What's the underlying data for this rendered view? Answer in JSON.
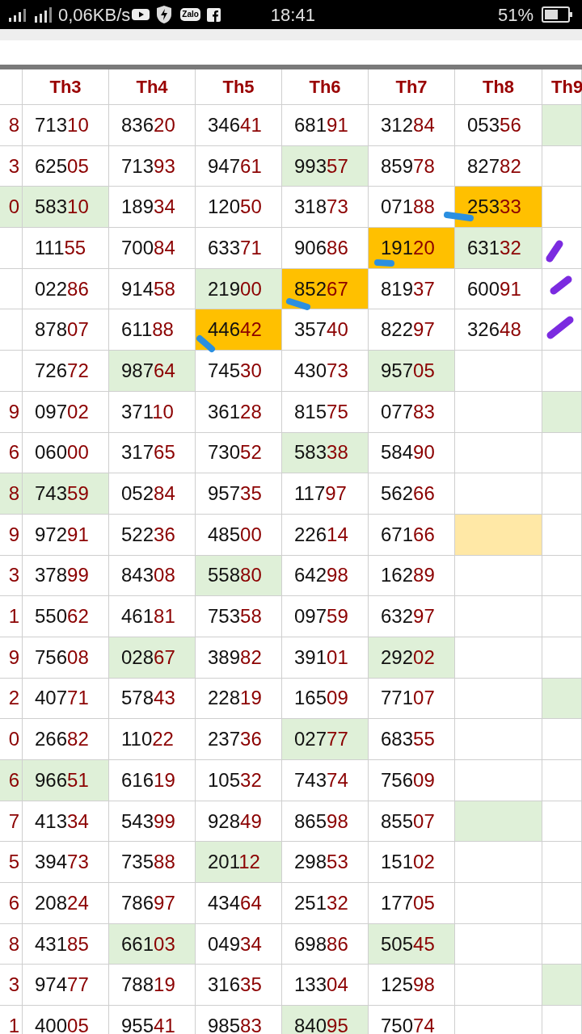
{
  "status_bar": {
    "speed": "0,06KB/s",
    "zalo": "Zalo",
    "time": "18:41",
    "battery": "51%"
  },
  "table": {
    "columns": [
      "",
      "Th3",
      "Th4",
      "Th5",
      "Th6",
      "Th7",
      "Th8",
      "Th9"
    ],
    "rows": [
      {
        "cells": [
          {
            "text": "8"
          },
          {
            "text": "71310"
          },
          {
            "text": "83620"
          },
          {
            "text": "34641"
          },
          {
            "text": "68191"
          },
          {
            "text": "31284"
          },
          {
            "text": "05356"
          },
          {
            "text": "",
            "color": "#dff0d8"
          }
        ]
      },
      {
        "cells": [
          {
            "text": "3"
          },
          {
            "text": "62505"
          },
          {
            "text": "71393"
          },
          {
            "text": "94761"
          },
          {
            "text": "99357",
            "color": "#dff0d8"
          },
          {
            "text": "85978"
          },
          {
            "text": "82782"
          },
          {
            "text": ""
          }
        ]
      },
      {
        "cells": [
          {
            "text": "0",
            "color": "#dff0d8"
          },
          {
            "text": "58310",
            "color": "#dff0d8"
          },
          {
            "text": "18934"
          },
          {
            "text": "12050"
          },
          {
            "text": "31873"
          },
          {
            "text": "07188"
          },
          {
            "text": "25333",
            "color": "#ffc000"
          },
          {
            "text": ""
          }
        ]
      },
      {
        "cells": [
          {
            "text": ""
          },
          {
            "text": "11155"
          },
          {
            "text": "70084"
          },
          {
            "text": "63371"
          },
          {
            "text": "90686"
          },
          {
            "text": "19120",
            "color": "#ffc000"
          },
          {
            "text": "63132",
            "color": "#dff0d8"
          },
          {
            "text": ""
          }
        ]
      },
      {
        "cells": [
          {
            "text": ""
          },
          {
            "text": "02286"
          },
          {
            "text": "91458"
          },
          {
            "text": "21900",
            "color": "#dff0d8"
          },
          {
            "text": "85267",
            "color": "#ffc000"
          },
          {
            "text": "81937"
          },
          {
            "text": "60091"
          },
          {
            "text": ""
          }
        ]
      },
      {
        "cells": [
          {
            "text": ""
          },
          {
            "text": "87807"
          },
          {
            "text": "61188"
          },
          {
            "text": "44642",
            "color": "#ffc000"
          },
          {
            "text": "35740"
          },
          {
            "text": "82297"
          },
          {
            "text": "32648"
          },
          {
            "text": ""
          }
        ]
      },
      {
        "cells": [
          {
            "text": ""
          },
          {
            "text": "72672"
          },
          {
            "text": "98764",
            "color": "#dff0d8"
          },
          {
            "text": "74530"
          },
          {
            "text": "43073"
          },
          {
            "text": "95705",
            "color": "#dff0d8"
          },
          {
            "text": ""
          },
          {
            "text": ""
          }
        ]
      },
      {
        "cells": [
          {
            "text": "9"
          },
          {
            "text": "09702"
          },
          {
            "text": "37110"
          },
          {
            "text": "36128"
          },
          {
            "text": "81575"
          },
          {
            "text": "07783"
          },
          {
            "text": ""
          },
          {
            "text": "",
            "color": "#dff0d8"
          }
        ]
      },
      {
        "cells": [
          {
            "text": "6"
          },
          {
            "text": "06000"
          },
          {
            "text": "31765"
          },
          {
            "text": "73052"
          },
          {
            "text": "58338",
            "color": "#dff0d8"
          },
          {
            "text": "58490"
          },
          {
            "text": ""
          },
          {
            "text": ""
          }
        ]
      },
      {
        "cells": [
          {
            "text": "8",
            "color": "#dff0d8"
          },
          {
            "text": "74359",
            "color": "#dff0d8"
          },
          {
            "text": "05284"
          },
          {
            "text": "95735"
          },
          {
            "text": "11797"
          },
          {
            "text": "56266"
          },
          {
            "text": ""
          },
          {
            "text": ""
          }
        ]
      },
      {
        "cells": [
          {
            "text": "9"
          },
          {
            "text": "97291"
          },
          {
            "text": "52236"
          },
          {
            "text": "48500"
          },
          {
            "text": "22614"
          },
          {
            "text": "67166"
          },
          {
            "text": "",
            "color": "#ffe8a6"
          },
          {
            "text": ""
          }
        ]
      },
      {
        "cells": [
          {
            "text": "3"
          },
          {
            "text": "37899"
          },
          {
            "text": "84308"
          },
          {
            "text": "55880",
            "color": "#dff0d8"
          },
          {
            "text": "64298"
          },
          {
            "text": "16289"
          },
          {
            "text": ""
          },
          {
            "text": ""
          }
        ]
      },
      {
        "cells": [
          {
            "text": "1"
          },
          {
            "text": "55062"
          },
          {
            "text": "46181"
          },
          {
            "text": "75358"
          },
          {
            "text": "09759"
          },
          {
            "text": "63297"
          },
          {
            "text": ""
          },
          {
            "text": ""
          }
        ]
      },
      {
        "cells": [
          {
            "text": "9"
          },
          {
            "text": "75608"
          },
          {
            "text": "02867",
            "color": "#dff0d8"
          },
          {
            "text": "38982"
          },
          {
            "text": "39101"
          },
          {
            "text": "29202",
            "color": "#dff0d8"
          },
          {
            "text": ""
          },
          {
            "text": ""
          }
        ]
      },
      {
        "cells": [
          {
            "text": "2"
          },
          {
            "text": "40771"
          },
          {
            "text": "57843"
          },
          {
            "text": "22819"
          },
          {
            "text": "16509"
          },
          {
            "text": "77107"
          },
          {
            "text": ""
          },
          {
            "text": "",
            "color": "#dff0d8"
          }
        ]
      },
      {
        "cells": [
          {
            "text": "0"
          },
          {
            "text": "26682"
          },
          {
            "text": "11022"
          },
          {
            "text": "23736"
          },
          {
            "text": "02777",
            "color": "#dff0d8"
          },
          {
            "text": "68355"
          },
          {
            "text": ""
          },
          {
            "text": ""
          }
        ]
      },
      {
        "cells": [
          {
            "text": "6",
            "color": "#dff0d8"
          },
          {
            "text": "96651",
            "color": "#dff0d8"
          },
          {
            "text": "61619"
          },
          {
            "text": "10532"
          },
          {
            "text": "74374"
          },
          {
            "text": "75609"
          },
          {
            "text": ""
          },
          {
            "text": ""
          }
        ]
      },
      {
        "cells": [
          {
            "text": "7"
          },
          {
            "text": "41334"
          },
          {
            "text": "54399"
          },
          {
            "text": "92849"
          },
          {
            "text": "86598"
          },
          {
            "text": "85507"
          },
          {
            "text": "",
            "color": "#dff0d8"
          },
          {
            "text": ""
          }
        ]
      },
      {
        "cells": [
          {
            "text": "5"
          },
          {
            "text": "39473"
          },
          {
            "text": "73588"
          },
          {
            "text": "20112",
            "color": "#dff0d8"
          },
          {
            "text": "29853"
          },
          {
            "text": "15102"
          },
          {
            "text": ""
          },
          {
            "text": ""
          }
        ]
      },
      {
        "cells": [
          {
            "text": "6"
          },
          {
            "text": "20824"
          },
          {
            "text": "78697"
          },
          {
            "text": "43464"
          },
          {
            "text": "25132"
          },
          {
            "text": "17705"
          },
          {
            "text": ""
          },
          {
            "text": ""
          }
        ]
      },
      {
        "cells": [
          {
            "text": "8"
          },
          {
            "text": "43185"
          },
          {
            "text": "66103",
            "color": "#dff0d8"
          },
          {
            "text": "04934"
          },
          {
            "text": "69886"
          },
          {
            "text": "50545",
            "color": "#dff0d8"
          },
          {
            "text": ""
          },
          {
            "text": ""
          }
        ]
      },
      {
        "cells": [
          {
            "text": "3"
          },
          {
            "text": "97477"
          },
          {
            "text": "78819"
          },
          {
            "text": "31635"
          },
          {
            "text": "13304"
          },
          {
            "text": "12598"
          },
          {
            "text": ""
          },
          {
            "text": "",
            "color": "#dff0d8"
          }
        ]
      },
      {
        "cells": [
          {
            "text": "1"
          },
          {
            "text": "40005"
          },
          {
            "text": "95541"
          },
          {
            "text": "98583"
          },
          {
            "text": "84095",
            "color": "#dff0d8"
          },
          {
            "text": "75074"
          },
          {
            "text": ""
          },
          {
            "text": ""
          }
        ]
      }
    ]
  }
}
